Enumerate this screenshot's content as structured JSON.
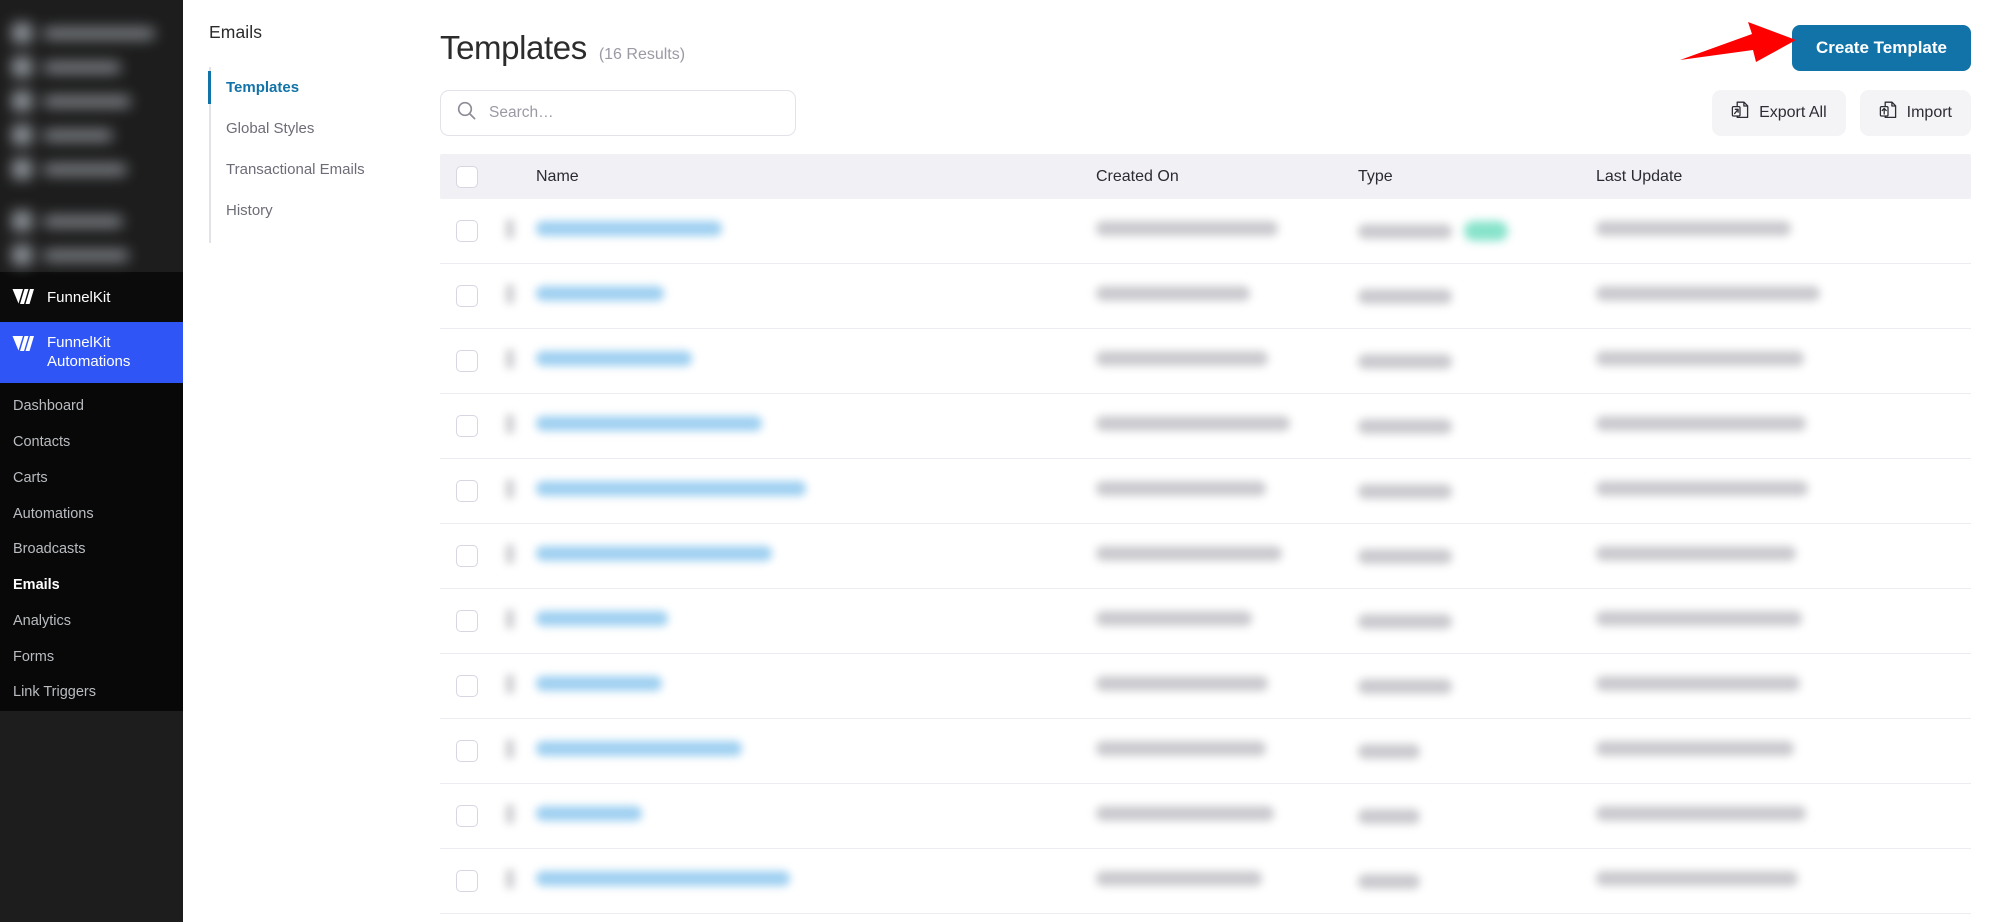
{
  "colors": {
    "accent": "#1273a8",
    "brand_active": "#2f55f7",
    "sidebar_bg": "#1d1d1d",
    "annotation": "#ff0000",
    "table_header_bg": "#f0f0f5",
    "badge_green": "#3fd2ac"
  },
  "wp_sidebar": {
    "blurred_items_count": 7,
    "brand": {
      "label": "FunnelKit",
      "icon": "funnelkit-logo-icon"
    },
    "active_item": {
      "label": "FunnelKit Automations",
      "icon": "funnelkit-logo-icon"
    },
    "menu": [
      {
        "label": "Dashboard",
        "current": false
      },
      {
        "label": "Contacts",
        "current": false
      },
      {
        "label": "Carts",
        "current": false
      },
      {
        "label": "Automations",
        "current": false
      },
      {
        "label": "Broadcasts",
        "current": false
      },
      {
        "label": "Emails",
        "current": true
      },
      {
        "label": "Analytics",
        "current": false
      },
      {
        "label": "Forms",
        "current": false
      },
      {
        "label": "Link Triggers",
        "current": false
      }
    ]
  },
  "sub_nav": {
    "title": "Emails",
    "items": [
      {
        "label": "Templates",
        "active": true
      },
      {
        "label": "Global Styles",
        "active": false
      },
      {
        "label": "Transactional Emails",
        "active": false
      },
      {
        "label": "History",
        "active": false
      }
    ]
  },
  "header": {
    "title": "Templates",
    "results": "(16 Results)",
    "create_button": "Create Template"
  },
  "toolbar": {
    "search_placeholder": "Search…",
    "search_value": "",
    "search_icon": "search-icon",
    "export_all": "Export All",
    "export_icon": "export-document-icon",
    "import": "Import",
    "import_icon": "import-document-icon"
  },
  "table": {
    "columns": [
      "Name",
      "Created On",
      "Type",
      "Last Update"
    ],
    "rows": [
      {
        "name_w": 186,
        "created_w": 182,
        "type_w": 94,
        "badge": true,
        "update_w": 195
      },
      {
        "name_w": 128,
        "created_w": 154,
        "type_w": 94,
        "badge": false,
        "update_w": 224
      },
      {
        "name_w": 156,
        "created_w": 172,
        "type_w": 94,
        "badge": false,
        "update_w": 208
      },
      {
        "name_w": 226,
        "created_w": 194,
        "type_w": 94,
        "badge": false,
        "update_w": 210
      },
      {
        "name_w": 270,
        "created_w": 170,
        "type_w": 94,
        "badge": false,
        "update_w": 212
      },
      {
        "name_w": 236,
        "created_w": 186,
        "type_w": 94,
        "badge": false,
        "update_w": 200
      },
      {
        "name_w": 132,
        "created_w": 156,
        "type_w": 94,
        "badge": false,
        "update_w": 206
      },
      {
        "name_w": 126,
        "created_w": 172,
        "type_w": 94,
        "badge": false,
        "update_w": 204
      },
      {
        "name_w": 206,
        "created_w": 170,
        "type_w": 62,
        "badge": false,
        "update_w": 198
      },
      {
        "name_w": 106,
        "created_w": 178,
        "type_w": 62,
        "badge": false,
        "update_w": 210
      },
      {
        "name_w": 254,
        "created_w": 166,
        "type_w": 62,
        "badge": false,
        "update_w": 202
      }
    ]
  },
  "annotation": {
    "type": "red-arrow",
    "points_to": "Create Template"
  }
}
